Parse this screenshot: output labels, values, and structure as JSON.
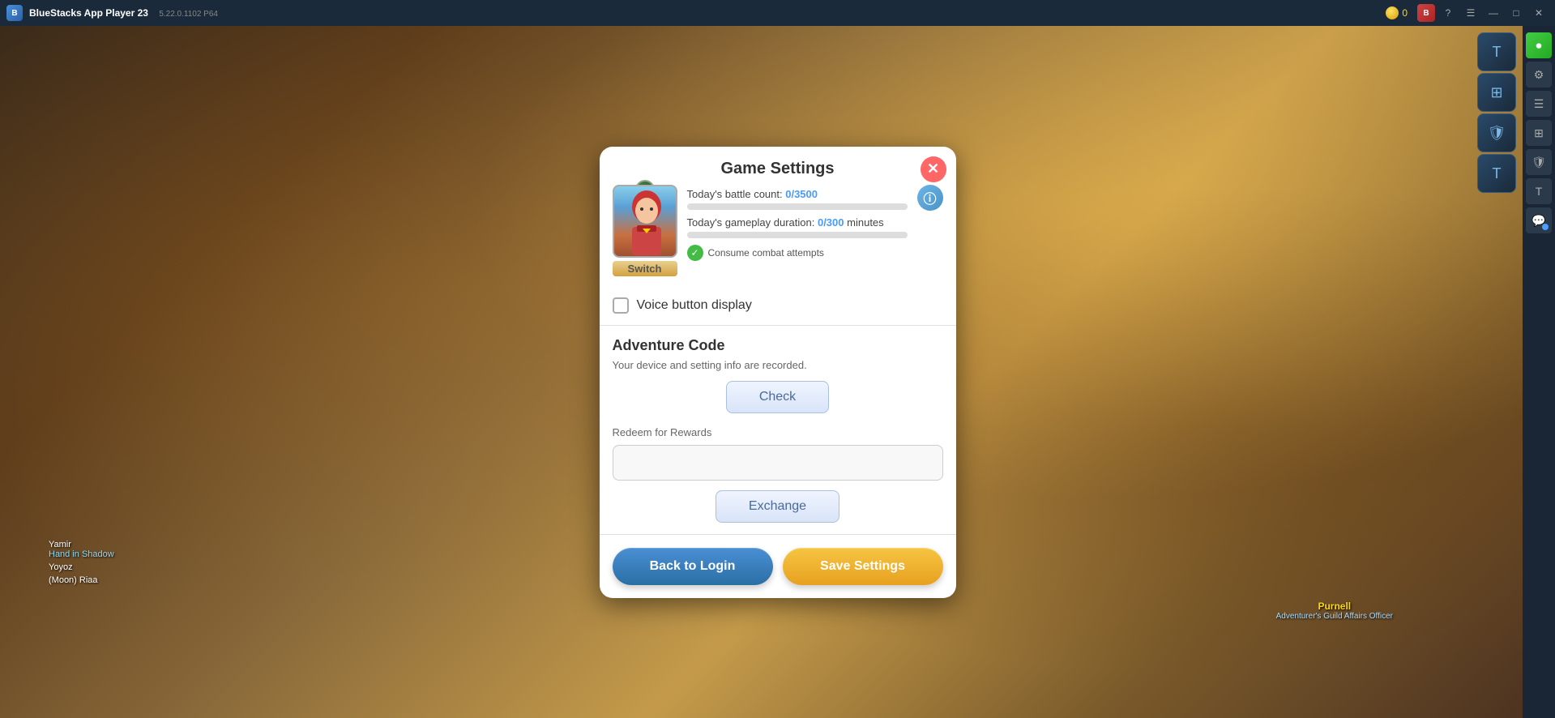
{
  "app": {
    "title": "BlueStacks App Player 23",
    "version": "5.22.0.1102  P64",
    "coin_count": "0"
  },
  "titlebar": {
    "back_label": "←",
    "home_label": "⌂",
    "menu_label": "☰",
    "minimize_label": "—",
    "maximize_label": "□",
    "close_label": "✕",
    "help_label": "?",
    "account_label": "👤"
  },
  "modal": {
    "title": "Game Settings",
    "close_label": "✕",
    "info_label": "ⓘ",
    "battle_count_label": "Today's battle count: ",
    "battle_count_value": "0/3500",
    "gameplay_duration_label": "Today's gameplay duration: ",
    "gameplay_duration_value": "0/300",
    "gameplay_duration_unit": " minutes",
    "consume_label": "Consume combat attempts",
    "voice_button_label": "Voice button display",
    "adventure_code_title": "Adventure Code",
    "adventure_code_desc": "Your device and setting info are recorded.",
    "check_label": "Check",
    "redeem_label": "Redeem for Rewards",
    "redeem_placeholder": "",
    "exchange_label": "Exchange",
    "back_to_login_label": "Back to Login",
    "save_settings_label": "Save Settings"
  },
  "avatar": {
    "switch_label": "Switch",
    "icon_symbol": "🦎"
  },
  "sidebar": {
    "icons": [
      "⚙",
      "☰",
      "⊞",
      "🛡",
      "T",
      "💬"
    ]
  },
  "game_panel": {
    "icons": [
      "T",
      "⊞",
      "🛡",
      "T"
    ]
  },
  "npc": {
    "name": "Purnell",
    "title": "Adventurer's Guild Affairs Officer"
  },
  "players": [
    {
      "name": "Yamir",
      "guild": "Hand in Shadow"
    },
    {
      "name": "Yoyoz",
      "guild": ""
    },
    {
      "name": "(Moon) Riaa",
      "guild": ""
    }
  ]
}
